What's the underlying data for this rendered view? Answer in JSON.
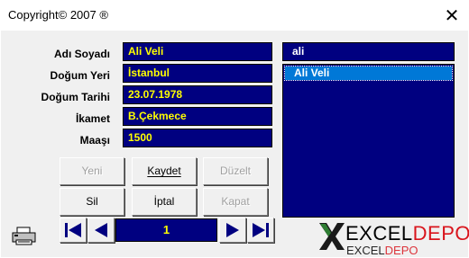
{
  "window": {
    "title": "Copyright© 2007 ®",
    "close_glyph": "✕"
  },
  "form": {
    "fields": [
      {
        "label": "Adı Soyadı",
        "value": "Ali Veli"
      },
      {
        "label": "Doğum Yeri",
        "value": "İstanbul"
      },
      {
        "label": "Doğum Tarihi",
        "value": "23.07.1978"
      },
      {
        "label": "İkamet",
        "value": "B.Çekmece"
      },
      {
        "label": "Maaşı",
        "value": "1500"
      }
    ],
    "colors": {
      "field_bg": "#000080",
      "field_text": "#ffff00",
      "window_bg": "#f0f0f0"
    }
  },
  "search": {
    "value": "ali"
  },
  "list": {
    "items": [
      "Ali Veli"
    ],
    "selected_index": 0
  },
  "buttons": {
    "row1": [
      {
        "label": "Yeni",
        "disabled": true
      },
      {
        "label": "Kaydet",
        "disabled": false
      },
      {
        "label": "Düzelt",
        "disabled": true
      }
    ],
    "row2": [
      {
        "label": "Sil",
        "disabled": false
      },
      {
        "label": "İptal",
        "disabled": false
      },
      {
        "label": "Kapat",
        "disabled": true
      }
    ]
  },
  "navigation": {
    "current_record": "1",
    "icons": [
      "first-record-icon",
      "previous-record-icon",
      "next-record-icon",
      "last-record-icon"
    ]
  },
  "logo": {
    "icon": "excel-x-logo-icon",
    "text_main": "EXCEL",
    "text_accent": "DEPO",
    "accent_color": "#d9141c"
  },
  "printer": {
    "icon": "printer-icon"
  }
}
